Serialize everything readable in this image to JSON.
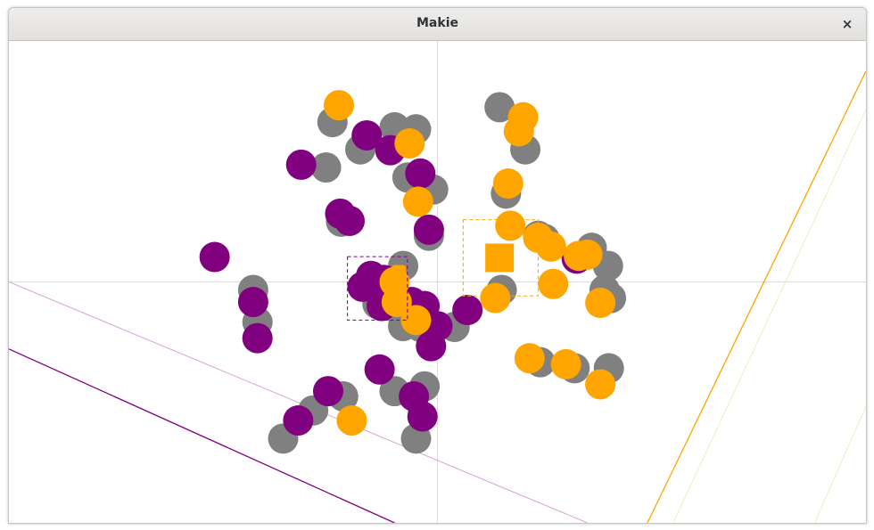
{
  "window": {
    "title": "Makie",
    "close_glyph": "×"
  },
  "colors": {
    "orange": "#FFA500",
    "purple": "#800080",
    "gray": "#808080",
    "light_purple": "#D8A3D8",
    "light_orange": "#F5E6B0",
    "axis": "#DDDDDD"
  },
  "chart_data": {
    "type": "scatter",
    "xlim": [
      -1.0,
      1.0
    ],
    "ylim": [
      -0.6,
      0.6
    ],
    "grid": true,
    "series": [
      {
        "color": "gray",
        "values": [
          [
            -0.245,
            0.398
          ],
          [
            -0.1,
            0.385
          ],
          [
            -0.05,
            0.38
          ],
          [
            -0.18,
            0.33
          ],
          [
            -0.26,
            0.285
          ],
          [
            -0.07,
            0.26
          ],
          [
            -0.01,
            0.23
          ],
          [
            -0.225,
            0.15
          ],
          [
            -0.02,
            0.115
          ],
          [
            -0.08,
            0.04
          ],
          [
            -0.43,
            -0.02
          ],
          [
            -0.42,
            -0.1
          ],
          [
            -0.14,
            -0.055
          ],
          [
            -0.11,
            -0.06
          ],
          [
            -0.08,
            -0.11
          ],
          [
            -0.04,
            -0.112
          ],
          [
            0.04,
            -0.112
          ],
          [
            -0.22,
            -0.285
          ],
          [
            -0.1,
            -0.272
          ],
          [
            -0.03,
            -0.26
          ],
          [
            -0.29,
            -0.32
          ],
          [
            -0.36,
            -0.39
          ],
          [
            -0.05,
            -0.39
          ],
          [
            0.145,
            0.435
          ],
          [
            0.205,
            0.33
          ],
          [
            0.16,
            0.22
          ],
          [
            0.235,
            0.115
          ],
          [
            0.25,
            0.107
          ],
          [
            0.36,
            0.085
          ],
          [
            0.398,
            0.04
          ],
          [
            0.15,
            -0.02
          ],
          [
            0.39,
            -0.02
          ],
          [
            0.405,
            -0.04
          ],
          [
            0.24,
            -0.2
          ],
          [
            0.32,
            -0.215
          ],
          [
            0.4,
            -0.215
          ]
        ]
      },
      {
        "color": "purple",
        "values": [
          [
            -0.165,
            0.365
          ],
          [
            -0.318,
            0.292
          ],
          [
            -0.11,
            0.328
          ],
          [
            -0.04,
            0.27
          ],
          [
            -0.227,
            0.17
          ],
          [
            -0.205,
            0.152
          ],
          [
            -0.02,
            0.13
          ],
          [
            -0.52,
            0.062
          ],
          [
            -0.175,
            -0.012
          ],
          [
            -0.155,
            0.015
          ],
          [
            -0.125,
            0.005
          ],
          [
            -0.13,
            -0.06
          ],
          [
            -0.06,
            -0.05
          ],
          [
            -0.03,
            -0.06
          ],
          [
            -0.115,
            -0.045
          ],
          [
            -0.43,
            -0.05
          ],
          [
            0.0,
            -0.11
          ],
          [
            -0.03,
            -0.09
          ],
          [
            -0.42,
            -0.14
          ],
          [
            0.07,
            -0.07
          ],
          [
            -0.015,
            -0.16
          ],
          [
            -0.135,
            -0.218
          ],
          [
            -0.255,
            -0.272
          ],
          [
            -0.055,
            -0.285
          ],
          [
            -0.035,
            -0.335
          ],
          [
            -0.325,
            -0.345
          ],
          [
            0.325,
            0.058
          ]
        ]
      },
      {
        "color": "orange",
        "values": [
          [
            -0.23,
            0.44
          ],
          [
            0.2,
            0.41
          ],
          [
            0.19,
            0.375
          ],
          [
            -0.065,
            0.345
          ],
          [
            0.165,
            0.245
          ],
          [
            -0.045,
            0.2
          ],
          [
            0.17,
            0.14
          ],
          [
            0.235,
            0.11
          ],
          [
            0.265,
            0.088
          ],
          [
            0.33,
            0.065
          ],
          [
            0.35,
            0.068
          ],
          [
            -0.1,
            -0.0
          ],
          [
            -0.095,
            -0.05
          ],
          [
            0.27,
            -0.005
          ],
          [
            0.135,
            -0.04
          ],
          [
            0.38,
            -0.052
          ],
          [
            -0.05,
            -0.095
          ],
          [
            0.215,
            -0.19
          ],
          [
            0.3,
            -0.205
          ],
          [
            0.38,
            -0.255
          ],
          [
            -0.2,
            -0.345
          ]
        ]
      }
    ],
    "markers": [
      {
        "shape": "square",
        "color": "orange",
        "x": 0.145,
        "y": 0.06
      },
      {
        "shape": "bar",
        "color": "orange",
        "x": -0.09,
        "y": -0.02
      }
    ],
    "selection_boxes": [
      {
        "color": "purple",
        "x0": -0.21,
        "x1": -0.07,
        "y0": -0.095,
        "y1": 0.063
      },
      {
        "color": "orange",
        "x0": 0.06,
        "x1": 0.235,
        "y0": -0.035,
        "y1": 0.155
      }
    ],
    "lines": [
      {
        "color": "purple",
        "width": 1.3,
        "points": [
          [
            -1.0,
            -0.167
          ],
          [
            -0.1,
            -0.6
          ]
        ]
      },
      {
        "color": "light_purple",
        "width": 1.0,
        "points": [
          [
            -1.0,
            0.0
          ],
          [
            0.35,
            -0.6
          ]
        ]
      },
      {
        "color": "orange",
        "width": 1.3,
        "points": [
          [
            0.49,
            -0.6
          ],
          [
            1.0,
            0.525
          ]
        ]
      },
      {
        "color": "light_orange",
        "width": 0.8,
        "points": [
          [
            0.55,
            -0.6
          ],
          [
            1.0,
            0.43
          ]
        ]
      },
      {
        "color": "light_orange",
        "width": 0.8,
        "points": [
          [
            0.88,
            -0.6
          ],
          [
            1.0,
            -0.31
          ]
        ]
      }
    ]
  }
}
